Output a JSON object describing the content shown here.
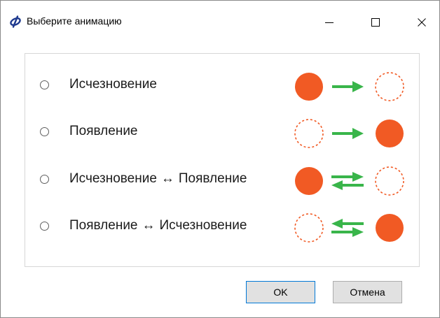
{
  "window": {
    "title": "Выберите анимацию",
    "icon": "phi-app-icon",
    "controls": [
      "minimize-icon",
      "maximize-icon",
      "close-icon"
    ]
  },
  "options": [
    {
      "label": "Исчезновение",
      "selected": false,
      "animation": "filled-to-dashed"
    },
    {
      "label": "Появление",
      "selected": false,
      "animation": "dashed-to-filled"
    },
    {
      "label_a": "Исчезновение",
      "separator": "↔",
      "label_b": "Появление",
      "selected": false,
      "animation": "filled-swap-dashed"
    },
    {
      "label_a": "Появление",
      "separator": "↔",
      "label_b": "Исчезновение",
      "selected": false,
      "animation": "dashed-swap-filled"
    }
  ],
  "buttons": {
    "ok": "OK",
    "cancel": "Отмена"
  },
  "colors": {
    "circle": "#f15a24",
    "arrow": "#39b54a",
    "window_bg": "#ffffff",
    "group_border": "#d7d7d7"
  }
}
